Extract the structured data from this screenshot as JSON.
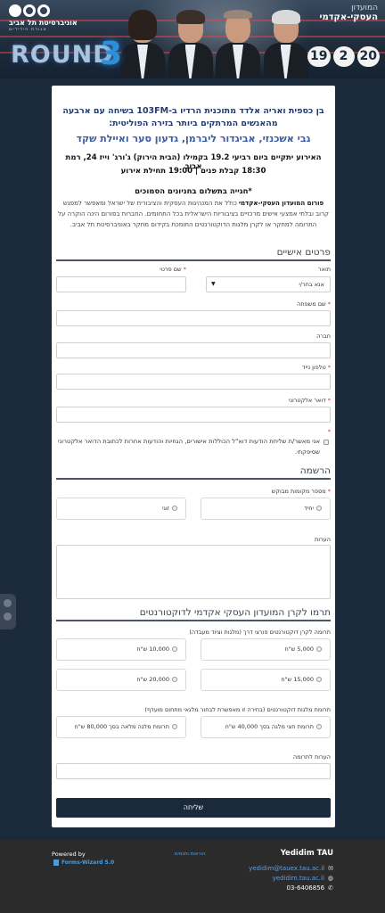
{
  "banner": {
    "logo_line1": "אוניברסיטת תל אביב",
    "logo_line2": "אגודת הידידים",
    "club_small": "המועדון",
    "club_big": "העסקי-אקדמי",
    "round_word": "ROUND",
    "round_number": "3",
    "date_parts": [
      "20",
      "2",
      "19"
    ]
  },
  "intro": {
    "line1": "בן כספית ואריה אלדד מתוכנית הרדיו ב-103FM בשיחה עם ארבעה מהאנשים המרתקים ביותר בזירה הפוליטית:",
    "line2": "גבי אשכנזי, אביגדור ליברמן, גדעון סער ואיילת שקד",
    "line3": "האירוע יתקיים ביום רביעי 19.2 בקמילו (הבית הירוק) ג'ורג' וייז 24, רמת אביב",
    "line4": "18:30 קבלת פנים | 19:00 תחילת אירוע",
    "line5": "*חגייה בתשלום בחניונים הסמוכים",
    "para_bold": "פורום המועדון העסקי-אקדמי",
    "para_rest": " כולל את המנהיגות העסקית והציבורית של ישראל ומאפשר למפגש קרוב ובלתי אמצעי אישים מרכזיים בציבוריות הישראלית בכל התחומים. החברות בפורום הינה הוקרה על התרומה למחקר או לקרן מלגות הדוקטורנטים התומכת בקידום מחקר באוניברסיטת תל אביב."
  },
  "personal": {
    "section_title": "פרטים אישיים",
    "title_label": "תואר",
    "title_value": "אנא בחר/י",
    "first_name_label": "שם פרטי",
    "last_name_label": "שם משפחה",
    "company_label": "חברה",
    "mobile_label": "טלפון נייד",
    "email_label": "דואר אלקטרוני",
    "consent_text": "אני מאשר/ת שליחת הודעות דוא\"ל הכוללות אישורים, הגחיות והודעות אחרות לכתובת הדואר אלקטרוני שסיפקתי."
  },
  "registration": {
    "section_title": "הרשמה",
    "seats_label": "מספר מקומות מבוקש",
    "opt_single": "יחיד",
    "opt_couple": "זוגי",
    "notes_label": "הערות"
  },
  "donation": {
    "section_title": "תרמו לקרן המועדון העסקי אקדמי לדוקטורנטים",
    "fund_label": "תרומה לקרן דוקטורנטים פורצי דרך (מלגות וציוד מעבדה)",
    "fund_options": [
      "5,000 ש\"ח",
      "10,000 ש\"ח",
      "15,000 ש\"ח",
      "20,000 ש\"ח"
    ],
    "scholar_label": "תרומת מלגות דוקטורנטים (בחירה זו מאפשרת לבחור מלגאי מתחום מועדף)",
    "scholar_options": [
      "תרומת חצי מלגה בסך 40,000 ש\"ח",
      "תרומת מלגה מלאה בסך 80,000 ש\"ח"
    ],
    "donation_notes_label": "הערות לתרומה",
    "submit_label": "שליחה"
  },
  "footer": {
    "brand": "Yedidim TAU",
    "email": "yedidim@tauex.tau.ac.il",
    "site": "yedidim.tau.ac.il",
    "phone": "03-6406856",
    "terms": "הוראות ותנאים",
    "powered_by": "Powered by",
    "forms_wizard": "Forms-Wizard 5.0"
  }
}
